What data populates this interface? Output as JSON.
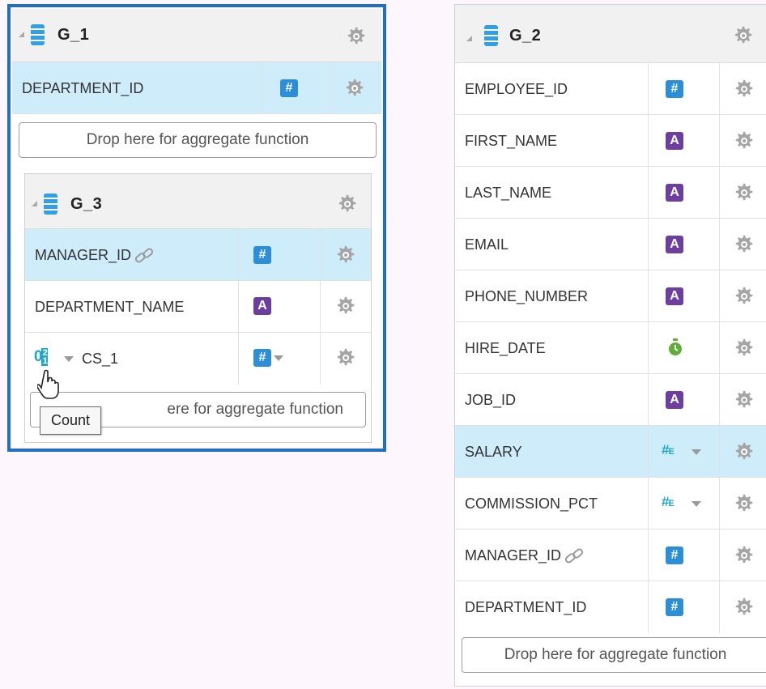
{
  "groups": {
    "g1": {
      "title": "G_1",
      "rows": [
        {
          "name": "DEPARTMENT_ID",
          "type": "number",
          "selected": true
        }
      ],
      "drop_label": "Drop here for aggregate function"
    },
    "g3": {
      "title": "G_3",
      "rows": [
        {
          "name": "MANAGER_ID",
          "type": "number",
          "linked": true,
          "selected": true
        },
        {
          "name": "DEPARTMENT_NAME",
          "type": "alpha"
        },
        {
          "name": "CS_1",
          "type": "number",
          "has_dropdown": true,
          "agg_icon": "count-icon"
        }
      ],
      "drop_label": "Drop here for aggregate function",
      "drop_visible": "ere for aggregate function"
    },
    "g2": {
      "title": "G_2",
      "rows": [
        {
          "name": "EMPLOYEE_ID",
          "type": "number"
        },
        {
          "name": "FIRST_NAME",
          "type": "alpha"
        },
        {
          "name": "LAST_NAME",
          "type": "alpha"
        },
        {
          "name": "EMAIL",
          "type": "alpha"
        },
        {
          "name": "PHONE_NUMBER",
          "type": "alpha"
        },
        {
          "name": "HIRE_DATE",
          "type": "date"
        },
        {
          "name": "JOB_ID",
          "type": "alpha"
        },
        {
          "name": "SALARY",
          "type": "number-e",
          "selected": true
        },
        {
          "name": "COMMISSION_PCT",
          "type": "number-e"
        },
        {
          "name": "MANAGER_ID",
          "type": "number",
          "linked": true
        },
        {
          "name": "DEPARTMENT_ID",
          "type": "number"
        }
      ],
      "drop_label": "Drop here for aggregate function"
    }
  },
  "type_icons": {
    "number": "#",
    "alpha": "A",
    "number_e": "#",
    "number_e_suffix": "E"
  },
  "tooltip": {
    "text": "Count"
  },
  "colors": {
    "selected_row": "#cfecfb",
    "focus_border": "#1f6fc7",
    "number_icon": "#2c8ed6",
    "alpha_icon": "#6c3f9e",
    "date_icon": "#5fae3a",
    "gear": "#a7a7a7",
    "background": "#fdf7fd"
  }
}
